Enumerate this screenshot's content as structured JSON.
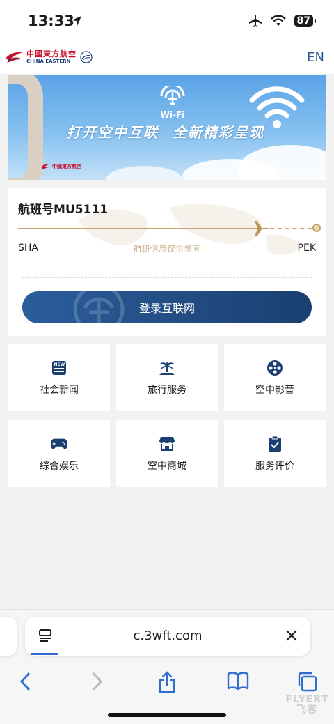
{
  "status_bar": {
    "time": "13:33",
    "battery": "87"
  },
  "header": {
    "brand_cn": "中國東方航空",
    "brand_en": "CHINA EASTERN",
    "lang_toggle": "EN"
  },
  "banner": {
    "wifi_label": "Wi-Fi",
    "slogan_left": "打开空中互联",
    "slogan_right": "全新精彩呈现",
    "mini_brand": "中國東方航空"
  },
  "flight": {
    "title": "航班号MU5111",
    "origin": "SHA",
    "destination": "PEK",
    "note": "航班信息仅供参考",
    "login_label": "登录互联网"
  },
  "services": [
    {
      "label": "社会新闻",
      "icon": "news-icon"
    },
    {
      "label": "旅行服务",
      "icon": "island-icon"
    },
    {
      "label": "空中影音",
      "icon": "film-reel-icon"
    },
    {
      "label": "综合娱乐",
      "icon": "gamepad-icon"
    },
    {
      "label": "空中商城",
      "icon": "store-icon"
    },
    {
      "label": "服务评价",
      "icon": "clipboard-check-icon"
    }
  ],
  "browser": {
    "url": "c.3wft.com"
  },
  "watermark": {
    "line1": "FLYERT",
    "line2": "飞客"
  },
  "colors": {
    "brand_blue": "#1b3f70",
    "gold": "#c4a46a",
    "brand_red": "#c8102e",
    "link_blue": "#2c5a94"
  }
}
